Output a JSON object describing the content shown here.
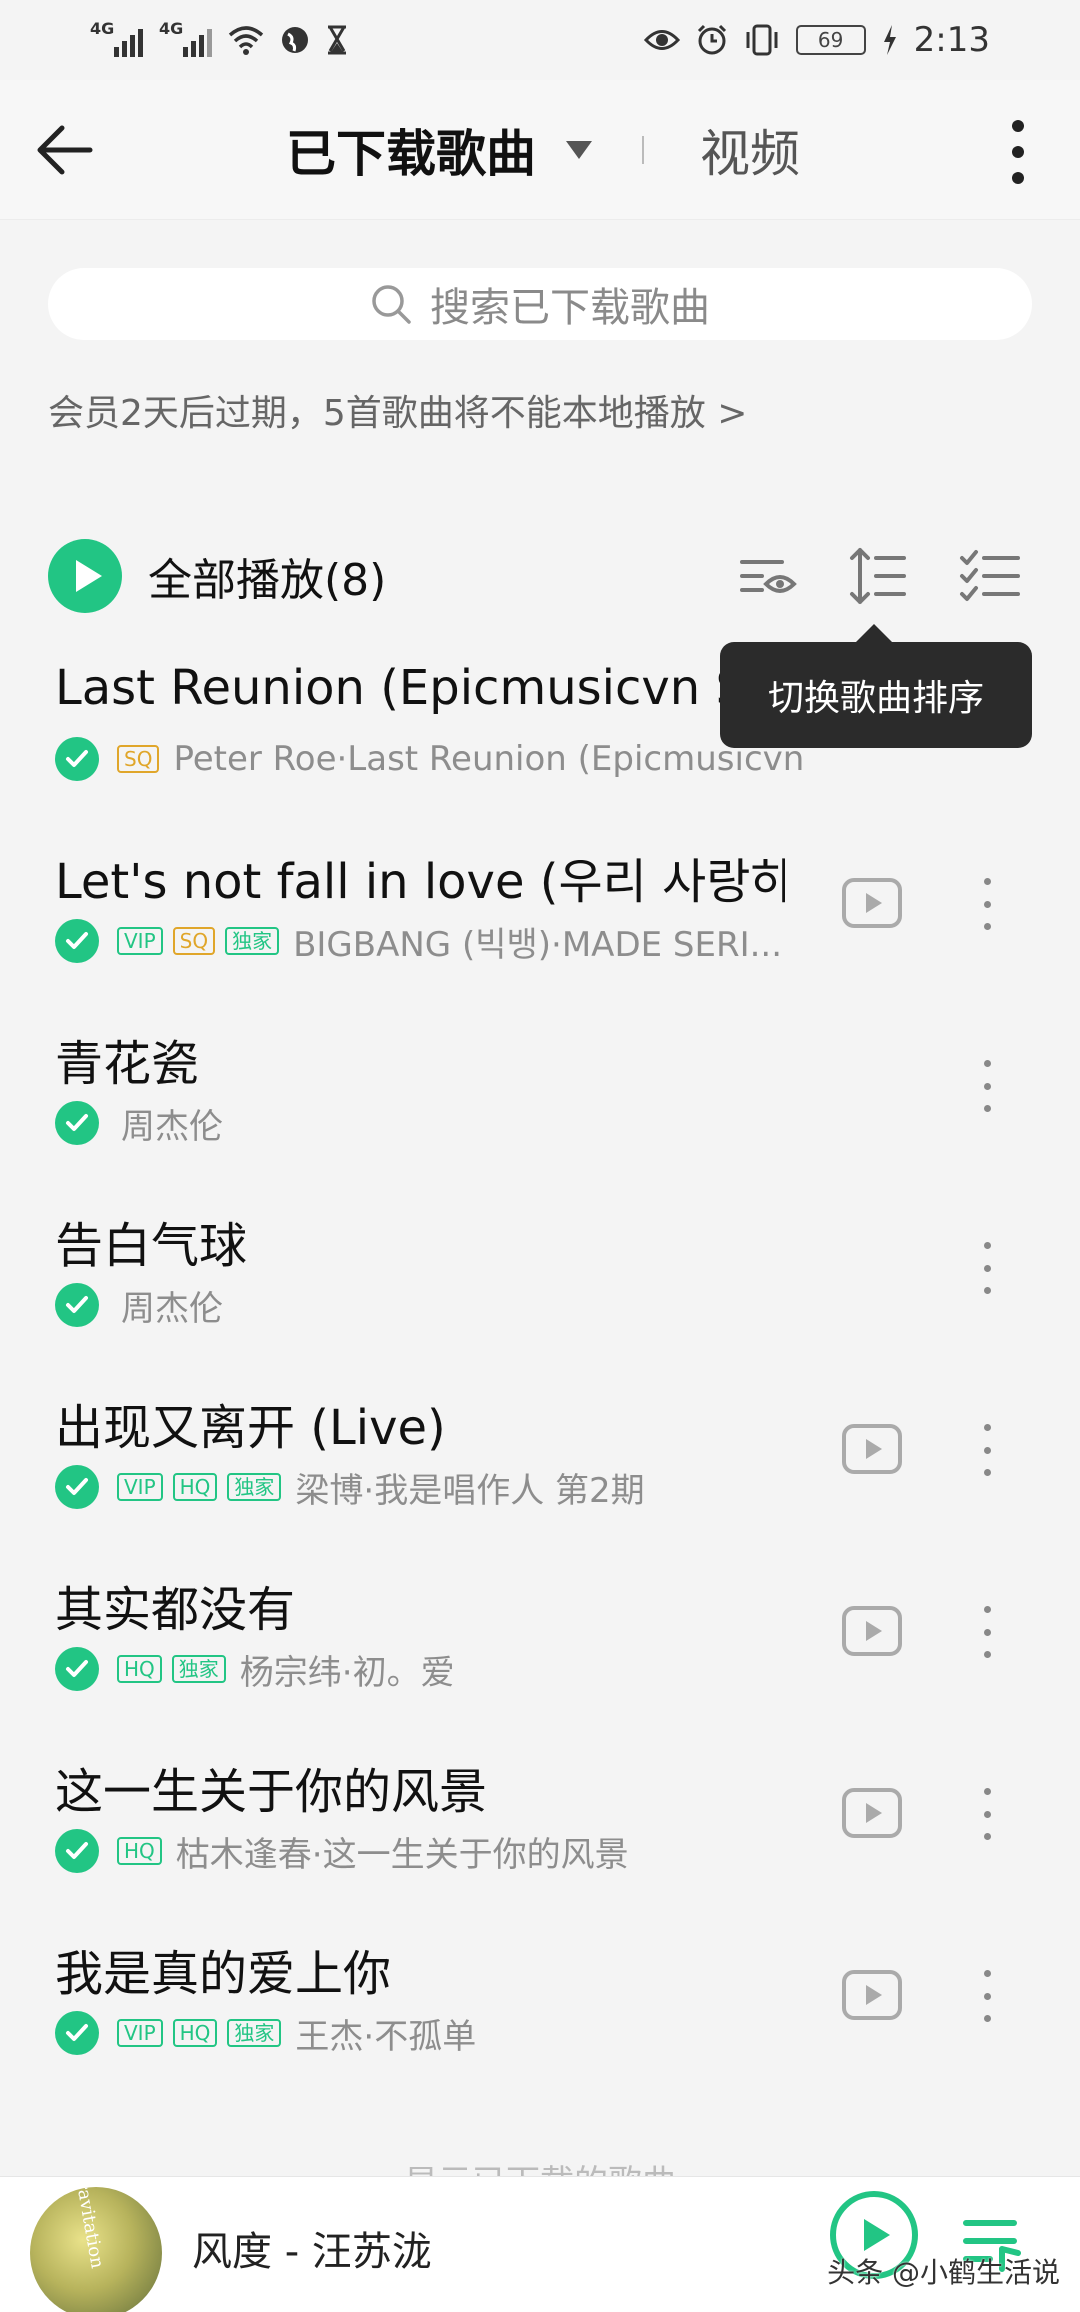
{
  "status_bar": {
    "signal1": "4G",
    "signal2": "4G",
    "battery": "69",
    "time": "2:13"
  },
  "header": {
    "title": "已下载歌曲",
    "video_tab": "视频"
  },
  "search": {
    "placeholder": "搜索已下载歌曲"
  },
  "notice": "会员2天后过期，5首歌曲将不能本地播放 >",
  "play_all": {
    "label": "全部播放(8)"
  },
  "tooltip": "切换歌曲排序",
  "songs": [
    {
      "title": "Last Reunion (Epicmusicvn Series)",
      "tags": [
        "SQ"
      ],
      "artist": "Peter Roe·Last Reunion (Epicmusicvn Series)",
      "mv": false
    },
    {
      "title": "Let's not fall in love (우리 사랑하...",
      "tags": [
        "VIP",
        "SQ",
        "独家"
      ],
      "artist": "BIGBANG (빅뱅)·MADE SERI...",
      "mv": true
    },
    {
      "title": "青花瓷",
      "tags": [],
      "artist": "周杰伦",
      "mv": false
    },
    {
      "title": "告白气球",
      "tags": [],
      "artist": "周杰伦",
      "mv": false
    },
    {
      "title": "出现又离开 (Live)",
      "tags": [
        "VIP",
        "HQ",
        "独家"
      ],
      "artist": "梁博·我是唱作人 第2期",
      "mv": true
    },
    {
      "title": "其实都没有",
      "tags": [
        "HQ",
        "独家"
      ],
      "artist": "杨宗纬·初。爱",
      "mv": true
    },
    {
      "title": "这一生关于你的风景",
      "tags": [
        "HQ"
      ],
      "artist": "枯木逢春·这一生关于你的风景",
      "mv": true
    },
    {
      "title": "我是真的爱上你",
      "tags": [
        "VIP",
        "HQ",
        "独家"
      ],
      "artist": "王杰·不孤单",
      "mv": true
    }
  ],
  "footer_hint": "显示已下载的歌曲",
  "player": {
    "now_playing": "风度 - 汪苏泷",
    "cover_text": "Gravitation",
    "watermark": "头条 @小鹤生活说"
  },
  "colors": {
    "accent": "#22c584",
    "sq_tag": "#e0a62a"
  }
}
